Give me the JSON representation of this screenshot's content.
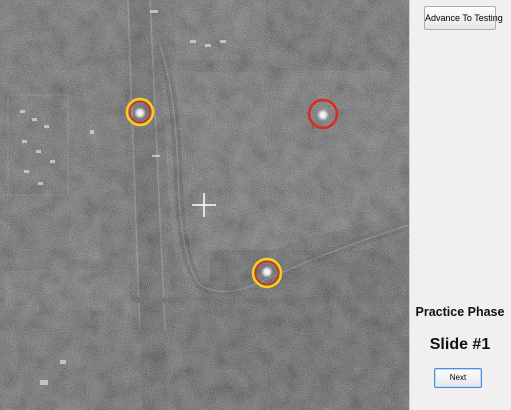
{
  "imagery": {
    "targets": [
      {
        "name": "marked-target-1",
        "ring_outer": "#f3d21d",
        "ring_inner": "#e0281e"
      },
      {
        "name": "marked-target-2",
        "ring_outer": "#e0281e",
        "ring_inner": "#e0281e"
      },
      {
        "name": "marked-target-3",
        "ring_outer": "#f3d21d",
        "ring_inner": "#e0281e"
      }
    ],
    "crosshair_color": "#ffffff"
  },
  "side_panel": {
    "advance_button_label": "Advance To Testing",
    "phase_label": "Practice Phase",
    "slide_label": "Slide #1",
    "next_button_label": "Next"
  }
}
